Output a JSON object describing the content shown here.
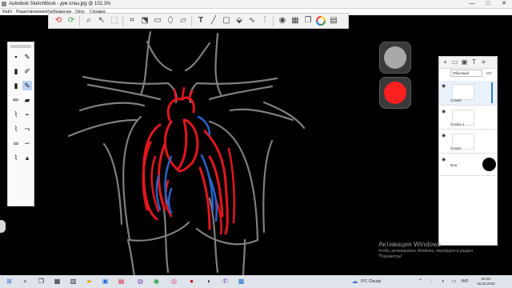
{
  "window": {
    "title": "Autodesk SketchBook - дик плаз.jpg @ 102,3%",
    "minimize": "—",
    "maximize": "□",
    "close": "✕"
  },
  "menu": [
    "Файл",
    "Редактирование",
    "Изображение",
    "Окно",
    "Справка"
  ],
  "toolbar": {
    "icons": [
      "undo-icon",
      "redo-icon",
      "zoom-icon",
      "move-icon",
      "select-icon",
      "crop-icon",
      "transform-icon",
      "ruler-icon",
      "ellipse-icon",
      "perspective-icon",
      "text-icon",
      "line-icon",
      "shape-icon",
      "fill-icon",
      "stroke-icon",
      "symmetry-icon",
      "copic-icon",
      "brushes-icon",
      "layers-icon",
      "color-wheel-icon",
      "swatches-icon"
    ]
  },
  "colors": {
    "secondary": "#a9a9a9",
    "primary": "#ff1f1f",
    "accent": "#2a7bd6"
  },
  "layers": {
    "blend_mode": "Обычный",
    "opacity_label": "100",
    "items": [
      {
        "name": "Слой2",
        "active": true
      },
      {
        "name": "Слой1-1",
        "active": false
      },
      {
        "name": "Слой1",
        "active": false
      },
      {
        "name": "Фон",
        "active": false
      }
    ]
  },
  "watermark": {
    "title": "Активация Windows",
    "text": "Чтобы активировать Windows, перейдите в раздел \"Параметры\"."
  },
  "taskbar": {
    "weather": "0°C Cloudy",
    "language": "УКР",
    "time": "03:25",
    "date": "15.02.2023"
  }
}
